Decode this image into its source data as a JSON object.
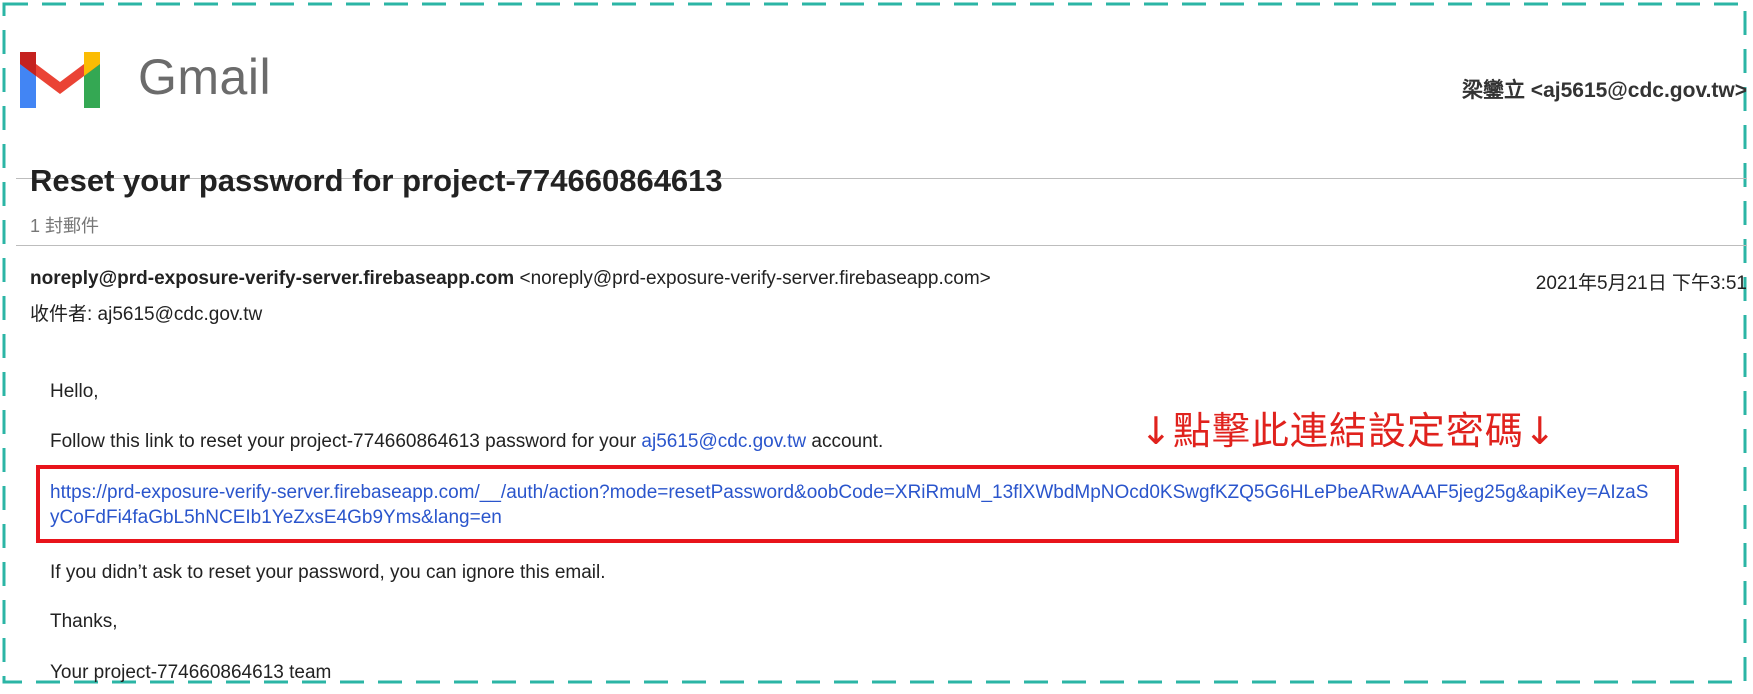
{
  "header": {
    "brand": "Gmail",
    "account": "梁鑾立 <aj5615@cdc.gov.tw>"
  },
  "thread": {
    "subject": "Reset your password for project-774660864613",
    "count": "1 封郵件"
  },
  "message": {
    "from_name": "noreply@prd-exposure-verify-server.firebaseapp.com",
    "from_addr": "<noreply@prd-exposure-verify-server.firebaseapp.com>",
    "date": "2021年5月21日 下午3:51",
    "to": "收件者: aj5615@cdc.gov.tw",
    "body": {
      "hello": "Hello,",
      "follow_pre": "Follow this link to reset your project-774660864613 password for your ",
      "follow_email": "aj5615@cdc.gov.tw",
      "follow_post": " account.",
      "reset_link": "https://prd-exposure-verify-server.firebaseapp.com/__/auth/action?mode=resetPassword&oobCode=XRiRmuM_13flXWbdMpNOcd0KSwgfKZQ5G6HLePbeARwAAAF5jeg25g&apiKey=AIzaSyCoFdFi4faGbL5hNCEIb1YeZxsE4Gb9Yms&lang=en",
      "ignore": "If you didn’t ask to reset your password, you can ignore this email.",
      "thanks": "Thanks,",
      "team": "Your project-774660864613 team"
    }
  },
  "annotation": {
    "text": "↓點擊此連結設定密碼↓",
    "color": "#e0221d",
    "box_color": "#e8141b"
  },
  "colors": {
    "frame": "#2bb5a5",
    "link": "#2a55cc"
  }
}
